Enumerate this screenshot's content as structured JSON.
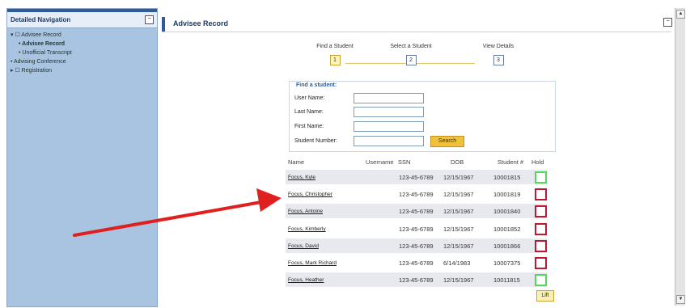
{
  "sidebar": {
    "title": "Detailed Navigation",
    "collapse_btn": "−",
    "items": [
      {
        "label": "▾ ☐ Advisee Record"
      },
      {
        "label": "• Advisee Record"
      },
      {
        "label": "• Unofficial Transcript"
      },
      {
        "label": "• Advising Conference"
      },
      {
        "label": "▸ ☐ Registration"
      }
    ]
  },
  "main": {
    "title": "Advisee Record",
    "collapse_btn": "−"
  },
  "steps": [
    {
      "label": "Find a Student",
      "num": "1"
    },
    {
      "label": "Select a Student",
      "num": "2"
    },
    {
      "label": "View Details",
      "num": "3"
    }
  ],
  "find_form": {
    "title": "Find a student:",
    "fields": [
      {
        "label": "User Name:",
        "value": ""
      },
      {
        "label": "Last Name:",
        "value": ""
      },
      {
        "label": "First Name:",
        "value": ""
      },
      {
        "label": "Student Number:",
        "value": ""
      }
    ],
    "search_label": "Search"
  },
  "results": {
    "headers": {
      "name": "Name",
      "username": "Username",
      "ssn": "SSN",
      "dob": "DOB",
      "student_num": "Student #",
      "hold": "Hold"
    },
    "rows": [
      {
        "name": "Focus, Kyle",
        "ssn": "123-45-6789",
        "dob": "12/15/1967",
        "student_num": "10001815",
        "hold": "green"
      },
      {
        "name": "Focus, Christopher",
        "ssn": "123-45-6789",
        "dob": "12/15/1967",
        "student_num": "10001819",
        "hold": "red"
      },
      {
        "name": "Focus, Antoine",
        "ssn": "123-45-6789",
        "dob": "12/15/1967",
        "student_num": "10001840",
        "hold": "red"
      },
      {
        "name": "Focus, Kimberly",
        "ssn": "123-45-6789",
        "dob": "12/15/1967",
        "student_num": "10001852",
        "hold": "red"
      },
      {
        "name": "Focus, David",
        "ssn": "123-45-6789",
        "dob": "12/15/1967",
        "student_num": "10001866",
        "hold": "red"
      },
      {
        "name": "Focus, Mark Richard",
        "ssn": "123-45-6789",
        "dob": "6/14/1983",
        "student_num": "10007375",
        "hold": "red"
      },
      {
        "name": "Focus, Heather",
        "ssn": "123-45-6789",
        "dob": "12/15/1967",
        "student_num": "10011815",
        "hold": "green"
      }
    ],
    "lift_label": "Lift"
  },
  "colors": {
    "hold_green": "#55d85a",
    "hold_red": "#c0182e",
    "arrow_red": "#e0201f",
    "sidebar_bg": "#a9c4e1"
  }
}
